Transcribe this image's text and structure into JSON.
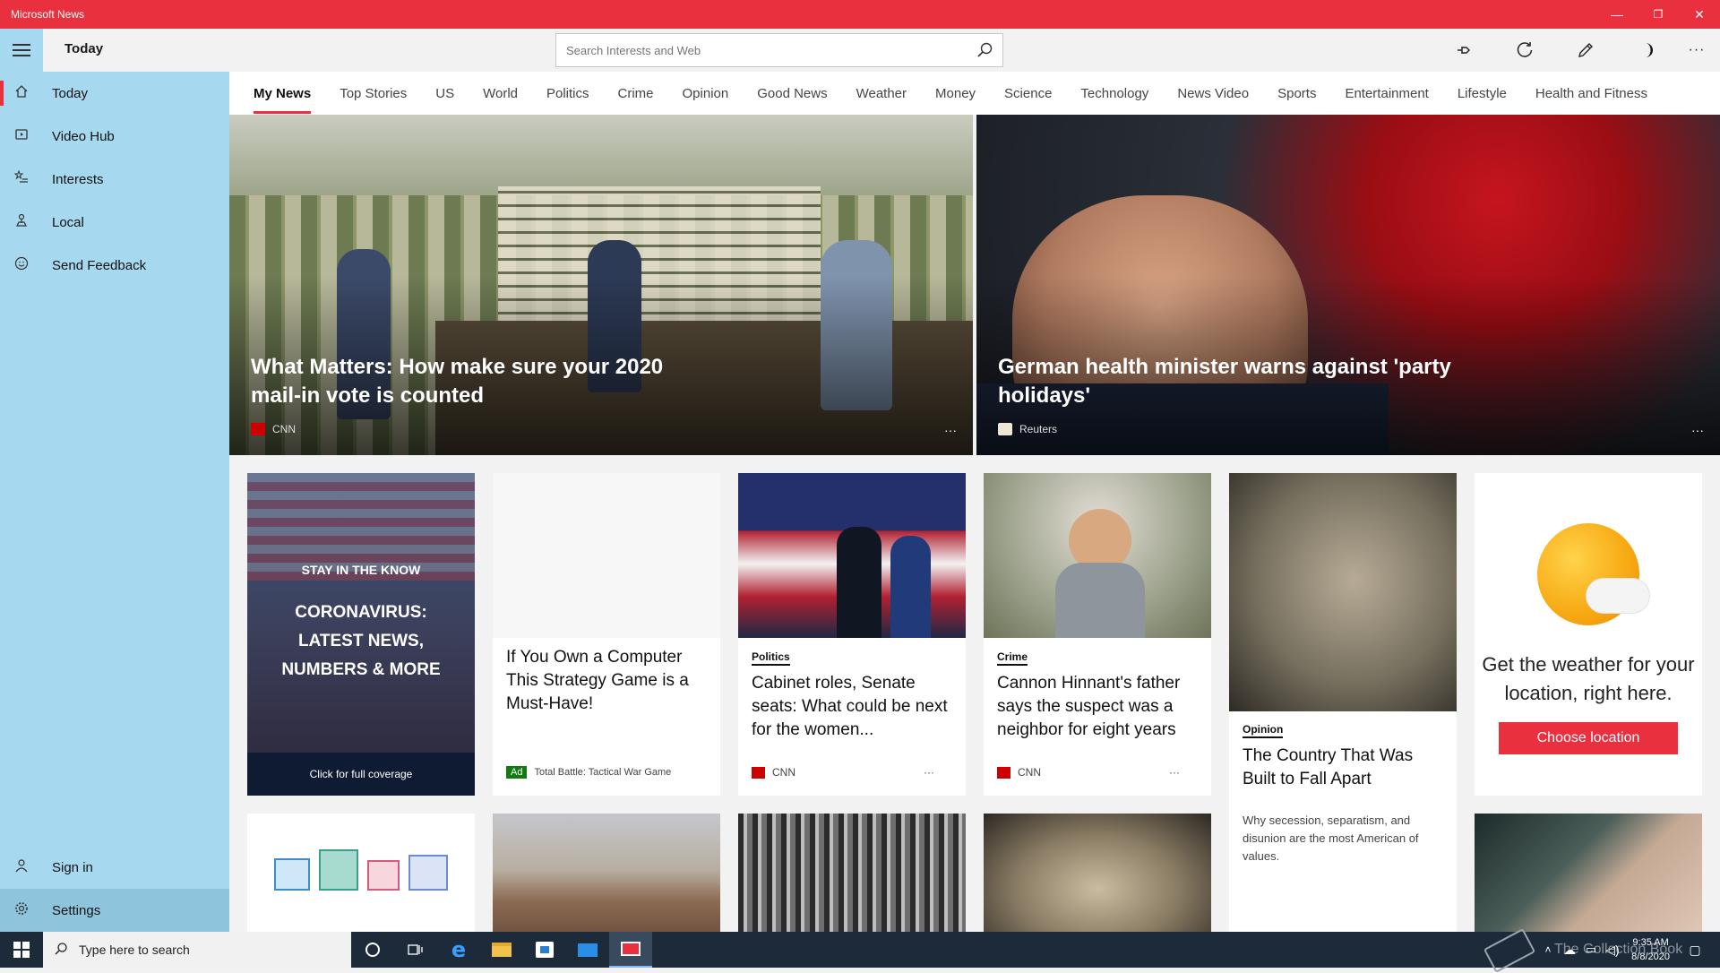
{
  "app": {
    "title": "Microsoft News",
    "window_controls": [
      "—",
      "❐",
      "✕"
    ]
  },
  "sidebar": {
    "items": [
      {
        "label": "Today",
        "icon": "home-icon"
      },
      {
        "label": "Video Hub",
        "icon": "video-icon"
      },
      {
        "label": "Interests",
        "icon": "star-list-icon"
      },
      {
        "label": "Local",
        "icon": "location-icon"
      },
      {
        "label": "Send Feedback",
        "icon": "smile-icon"
      }
    ],
    "bottom": [
      {
        "label": "Sign in",
        "icon": "person-icon"
      },
      {
        "label": "Settings",
        "icon": "gear-icon"
      }
    ]
  },
  "header": {
    "title": "Today",
    "search_placeholder": "Search Interests and Web",
    "buttons": [
      "pin-icon",
      "refresh-icon",
      "edit-icon",
      "dark-mode-icon",
      "more-icon"
    ]
  },
  "tabs": [
    "My News",
    "Top Stories",
    "US",
    "World",
    "Politics",
    "Crime",
    "Opinion",
    "Good News",
    "Weather",
    "Money",
    "Science",
    "Technology",
    "News Video",
    "Sports",
    "Entertainment",
    "Lifestyle",
    "Health and Fitness"
  ],
  "hero": [
    {
      "headline": "What Matters: How make sure your 2020 mail-in vote is counted",
      "source": "CNN",
      "more": "···"
    },
    {
      "headline": "German health minister warns against 'party holidays'",
      "source": "Reuters",
      "more": "···"
    }
  ],
  "cards": {
    "coverage": {
      "kicker": "STAY IN THE KNOW",
      "title": "CORONAVIRUS: LATEST NEWS, NUMBERS & MORE",
      "link": "Click for full coverage"
    },
    "ad": {
      "title": "If You Own a Computer This Strategy Game is a Must-Have!",
      "badge": "Ad",
      "source": "Total Battle: Tactical War Game"
    },
    "politics": {
      "category": "Politics",
      "title": "Cabinet roles, Senate seats: What could be next for the women...",
      "source": "CNN",
      "more": "···"
    },
    "crime": {
      "category": "Crime",
      "title": "Cannon Hinnant's father says the suspect was a neighbor for eight years",
      "source": "CNN",
      "more": "···"
    },
    "opinion": {
      "category": "Opinion",
      "title": "The Country That Was Built to Fall Apart",
      "summary": "Why secession, separatism, and disunion are the most American of values."
    },
    "weather": {
      "text": "Get the weather for your location, right here.",
      "button": "Choose location"
    }
  },
  "taskbar": {
    "search_placeholder": "Type here to search",
    "time": "9:35 AM",
    "date": "8/8/2020",
    "watermark": "The Collection Book"
  },
  "colors": {
    "accent": "#e8303e",
    "sidebar": "#a6d8ef",
    "taskbar": "#1c2a3a",
    "ad_green": "#107c10"
  }
}
